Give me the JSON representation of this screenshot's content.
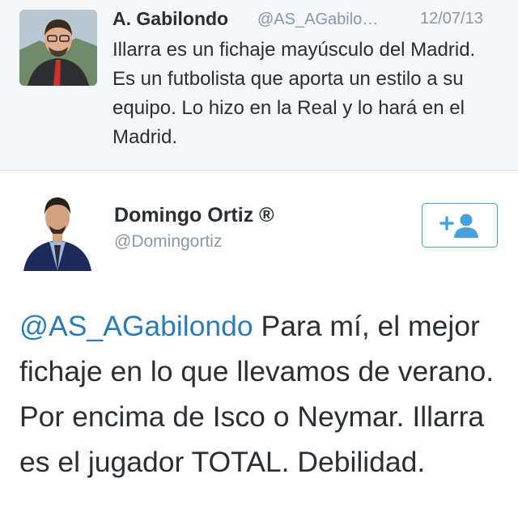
{
  "quoted_tweet": {
    "name": "A. Gabilondo",
    "handle": "@AS_AGabilo…",
    "date": "12/07/13",
    "text": "Illarra es un fichaje mayúsculo del Madrid. Es un futbolista que aporta un estilo a su equipo. Lo hizo en la Real y lo hará en el Madrid."
  },
  "main_tweet": {
    "name": "Domingo Ortiz ®",
    "handle": "@Domingortiz",
    "mention": "@AS_AGabilondo",
    "text": " Para mí, el mejor fichaje en lo que llevamos de verano. Por encima de Isco o Neymar. Illarra es el jugador TOTAL. Debilidad.",
    "follow_icon": "add-user-icon"
  },
  "colors": {
    "accent": "#2b7bb9",
    "follow_border": "#4a9fe0",
    "muted": "#8899a6",
    "text": "#292f33"
  }
}
